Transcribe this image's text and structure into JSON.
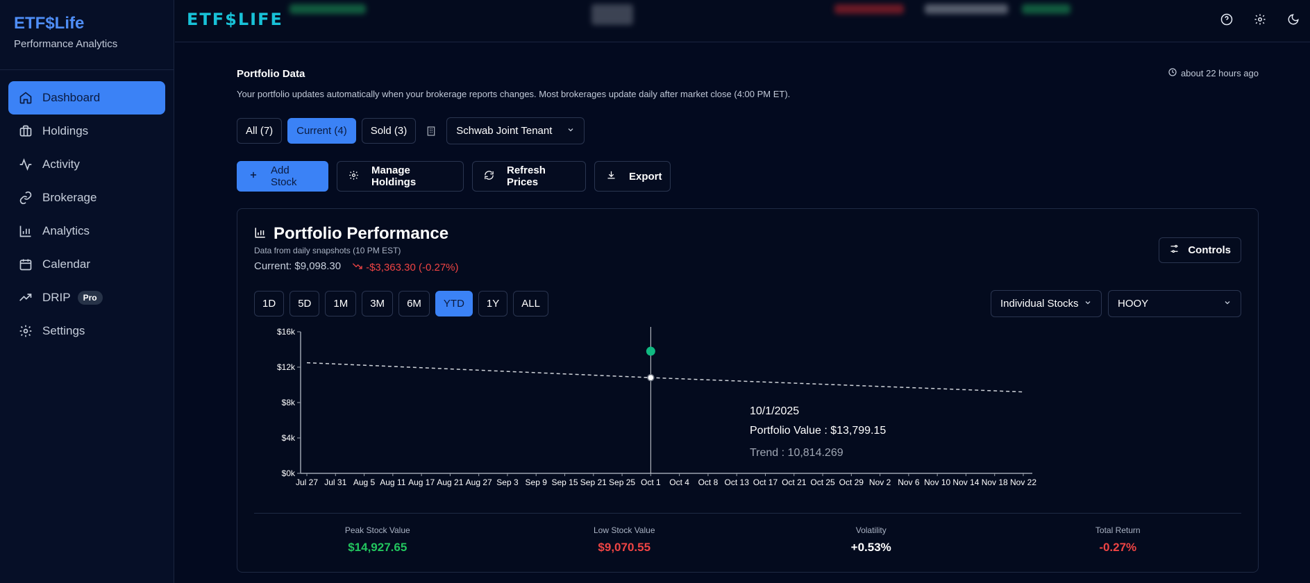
{
  "sidebar": {
    "brand_title": "ETF$Life",
    "brand_subtitle": "Performance Analytics",
    "items": [
      {
        "label": "Dashboard",
        "icon": "home-icon"
      },
      {
        "label": "Holdings",
        "icon": "briefcase-icon"
      },
      {
        "label": "Activity",
        "icon": "activity-icon"
      },
      {
        "label": "Brokerage",
        "icon": "link-icon"
      },
      {
        "label": "Analytics",
        "icon": "bar-chart-icon"
      },
      {
        "label": "Calendar",
        "icon": "calendar-icon"
      },
      {
        "label": "DRIP",
        "icon": "trending-up-icon",
        "badge": "Pro"
      },
      {
        "label": "Settings",
        "icon": "gear-icon"
      }
    ]
  },
  "topbar": {
    "logo": "ETF$LIFE",
    "icons": [
      "help-circle-icon",
      "gear-icon",
      "moon-icon"
    ]
  },
  "portfolio_data": {
    "title": "Portfolio Data",
    "updated": "about 22 hours ago",
    "description": "Your portfolio updates automatically when your brokerage reports changes. Most brokerages update daily after market close (4:00 PM ET).",
    "filters": [
      "All (7)",
      "Current (4)",
      "Sold (3)"
    ],
    "active_filter": "Current (4)",
    "account": "Schwab Joint Tenant",
    "actions": [
      "Add Stock",
      "Manage Holdings",
      "Refresh Prices",
      "Export"
    ]
  },
  "performance": {
    "title": "Portfolio Performance",
    "subtitle": "Data from daily snapshots (10 PM EST)",
    "current": "Current: $9,098.30",
    "change": "-$3,363.30 (-0.27%)",
    "controls_label": "Controls",
    "ranges": [
      "1D",
      "5D",
      "1M",
      "3M",
      "6M",
      "YTD",
      "1Y",
      "ALL"
    ],
    "active_range": "YTD",
    "view_mode": "Individual Stocks",
    "ticker": "HOOY",
    "tooltip": {
      "date": "10/1/2025",
      "value_line": "Portfolio Value : $13,799.15",
      "trend_line": "Trend : 10,814.269"
    },
    "stats": [
      {
        "label": "Peak Stock Value",
        "value": "$14,927.65",
        "color": "#22c55e"
      },
      {
        "label": "Low Stock Value",
        "value": "$9,070.55",
        "color": "#ef4444"
      },
      {
        "label": "Volatility",
        "value": "+0.53%",
        "color": "#ffffff"
      },
      {
        "label": "Total Return",
        "value": "-0.27%",
        "color": "#ef4444"
      }
    ]
  },
  "chart_data": {
    "type": "line",
    "title": "",
    "xlabel": "",
    "ylabel": "",
    "categories": [
      "Jul 27",
      "Jul 31",
      "Aug 5",
      "Aug 11",
      "Aug 17",
      "Aug 21",
      "Aug 27",
      "Sep 3",
      "Sep 9",
      "Sep 15",
      "Sep 21",
      "Sep 25",
      "Oct 1",
      "Oct 4",
      "Oct 8",
      "Oct 13",
      "Oct 17",
      "Oct 21",
      "Oct 25",
      "Oct 29",
      "Nov 2",
      "Nov 6",
      "Nov 10",
      "Nov 14",
      "Nov 18",
      "Nov 22"
    ],
    "y_ticks": [
      "$0k",
      "$4k",
      "$8k",
      "$12k",
      "$16k"
    ],
    "ylim": [
      0,
      16000
    ],
    "series": [
      {
        "type": "scatter",
        "points": [
          {
            "x": "Oct 1",
            "y": 13799.15
          }
        ]
      },
      {
        "type": "trend-dashed",
        "points": [
          {
            "x": "Jul 27",
            "y": 12500
          },
          {
            "x": "Oct 1",
            "y": 10814.269
          },
          {
            "x": "Nov 22",
            "y": 9200
          }
        ]
      }
    ],
    "colors": {
      "point": "#10b981",
      "trend": "#d1d5db",
      "axis": "#9ca3af"
    }
  }
}
